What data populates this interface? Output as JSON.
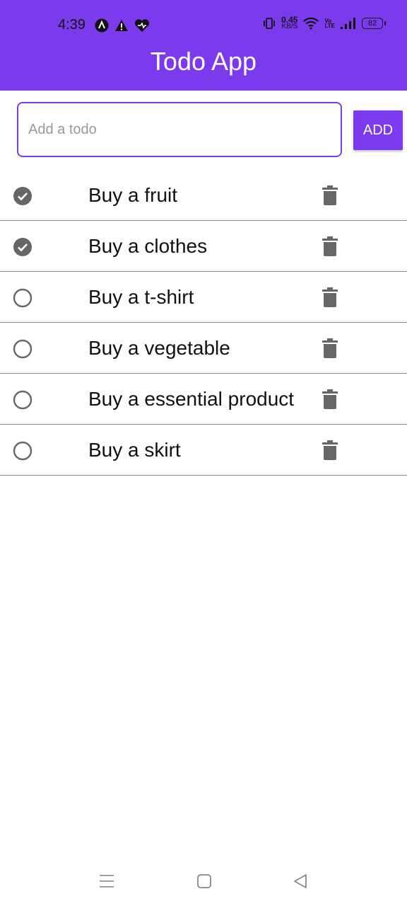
{
  "status_bar": {
    "time": "4:39",
    "net_speed_value": "0.45",
    "net_speed_unit": "KB/S",
    "volte_top": "Vo",
    "volte_bottom": "LTE",
    "battery": "82"
  },
  "app": {
    "title": "Todo App"
  },
  "input": {
    "placeholder": "Add a todo",
    "value": ""
  },
  "add_button": {
    "label": "ADD"
  },
  "todos": [
    {
      "text": "Buy a fruit",
      "done": true
    },
    {
      "text": "Buy a clothes",
      "done": true
    },
    {
      "text": "Buy a t-shirt",
      "done": false
    },
    {
      "text": "Buy a vegetable",
      "done": false
    },
    {
      "text": "Buy a essential product",
      "done": false
    },
    {
      "text": "Buy a skirt",
      "done": false
    }
  ],
  "colors": {
    "primary": "#7c3aed",
    "icon_gray": "#666666"
  }
}
